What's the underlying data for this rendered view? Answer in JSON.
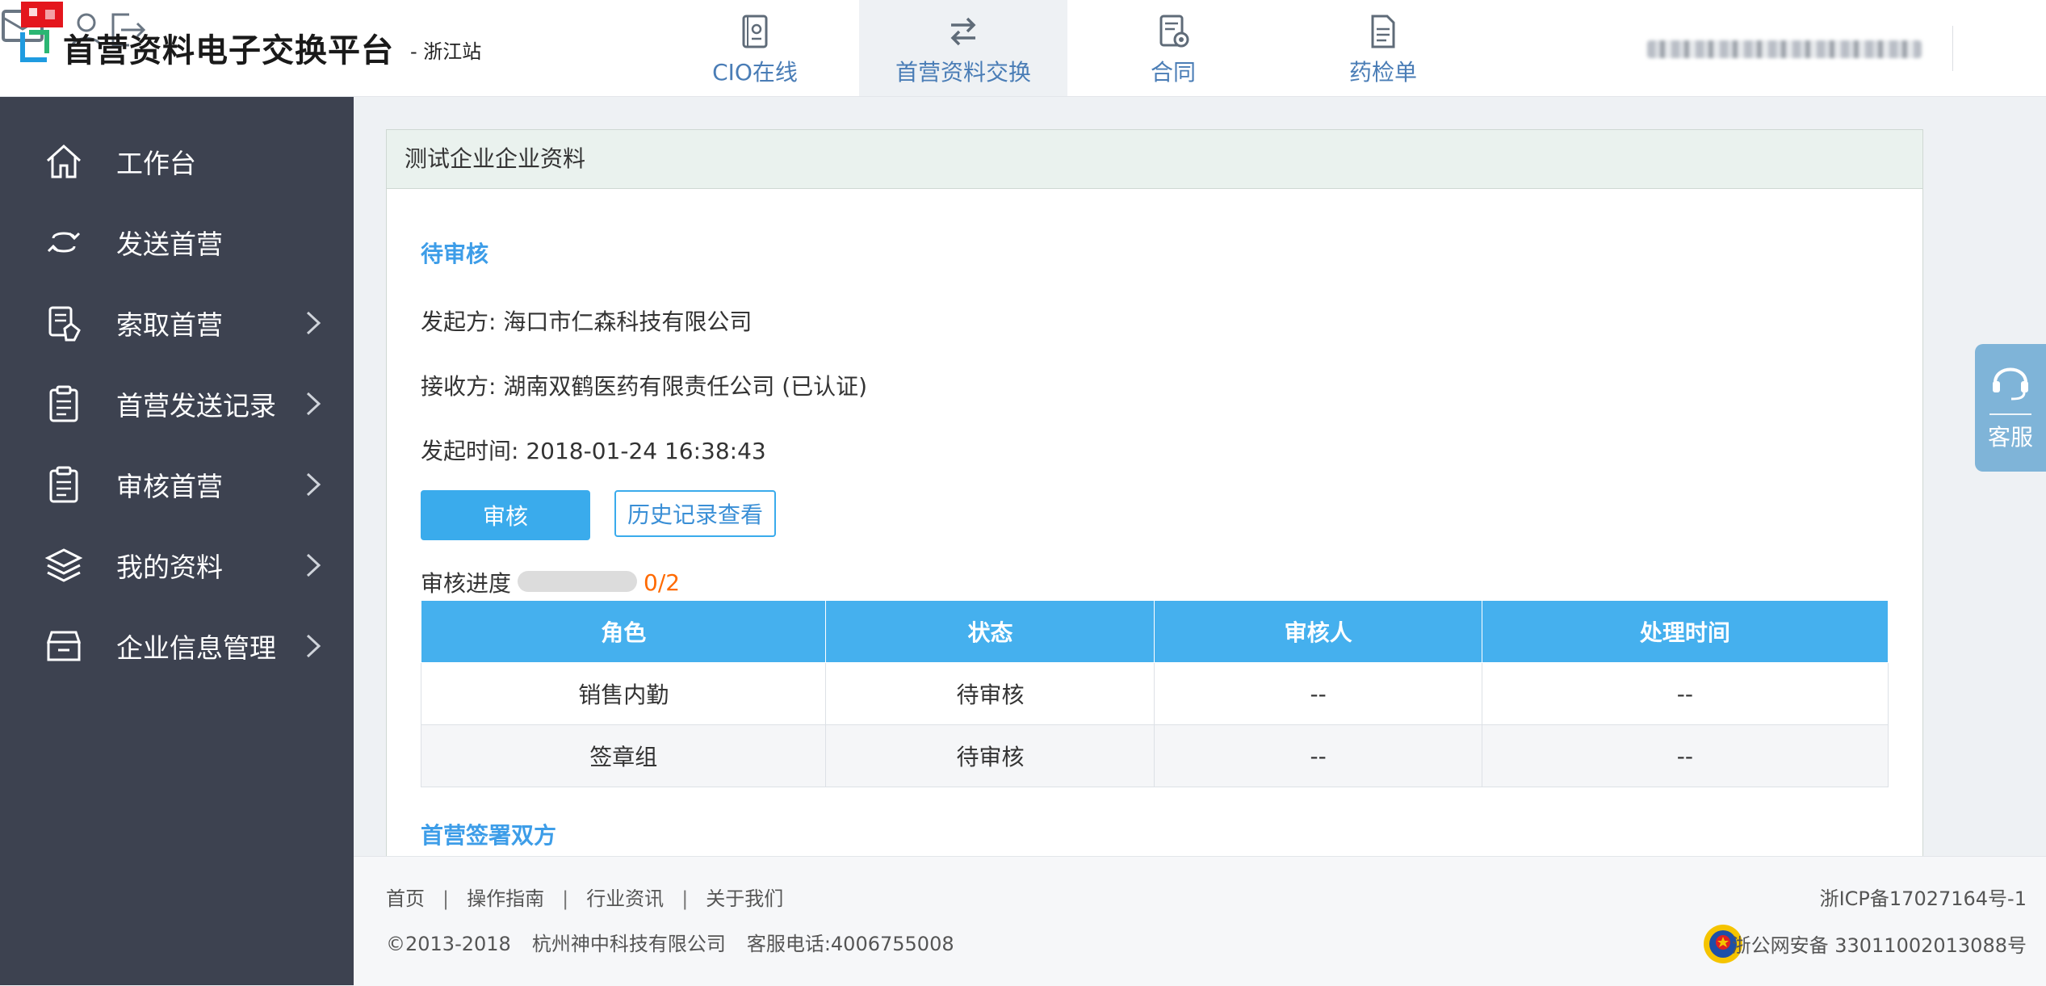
{
  "header": {
    "brand": "首营资料电子交换平台",
    "station": "- 浙江站",
    "nav": [
      {
        "label": "CIO在线",
        "icon": "book-icon"
      },
      {
        "label": "首营资料交换",
        "icon": "exchange-arrows-icon"
      },
      {
        "label": "合同",
        "icon": "contract-icon"
      },
      {
        "label": "药检单",
        "icon": "document-icon"
      }
    ],
    "active_nav": 1,
    "right_icons": [
      "notification-icon",
      "user-icon",
      "logout-icon"
    ]
  },
  "sidebar": {
    "items": [
      {
        "label": "工作台",
        "icon": "home-icon",
        "has_arrow": false
      },
      {
        "label": "发送首营",
        "icon": "send-loop-icon",
        "has_arrow": false
      },
      {
        "label": "索取首营",
        "icon": "request-hand-icon",
        "has_arrow": true
      },
      {
        "label": "首营发送记录",
        "icon": "clipboard-icon",
        "has_arrow": true
      },
      {
        "label": "审核首营",
        "icon": "clipboard-check-icon",
        "has_arrow": true
      },
      {
        "label": "我的资料",
        "icon": "layers-icon",
        "has_arrow": true
      },
      {
        "label": "企业信息管理",
        "icon": "archive-icon",
        "has_arrow": true
      }
    ]
  },
  "card": {
    "title": "测试企业企业资料",
    "status_title": "待审核",
    "initiator_label": "发起方:",
    "initiator": "海口市仁森科技有限公司",
    "receiver_label": "接收方:",
    "receiver": "湖南双鹤医药有限责任公司 (已认证)",
    "time_label": "发起时间:",
    "time": "2018-01-24 16:38:43",
    "review_button": "审核",
    "history_button": "历史记录查看",
    "progress_label": "审核进度",
    "progress_text": "0/2",
    "progress_fraction": 0,
    "table": {
      "headers": [
        "角色",
        "状态",
        "审核人",
        "处理时间"
      ],
      "rows": [
        [
          "销售内勤",
          "待审核",
          "--",
          "--"
        ],
        [
          "签章组",
          "待审核",
          "--",
          "--"
        ]
      ]
    },
    "next_section": "首营签署双方"
  },
  "footer": {
    "links": [
      "首页",
      "操作指南",
      "行业资讯",
      "关于我们"
    ],
    "separator": "|",
    "copyright": "©2013-2018",
    "company": "杭州神中科技有限公司",
    "phone": "客服电话:4006755008",
    "icp": "浙ICP备17027164号-1",
    "police": "浙公网安备 33011002013088号"
  },
  "service": {
    "label": "客服",
    "icon": "headset-icon"
  },
  "colors": {
    "accent": "#3aabec",
    "sidebar": "#3d4250",
    "progress_text": "#ff6a00",
    "nav_text": "#4a7db6"
  }
}
